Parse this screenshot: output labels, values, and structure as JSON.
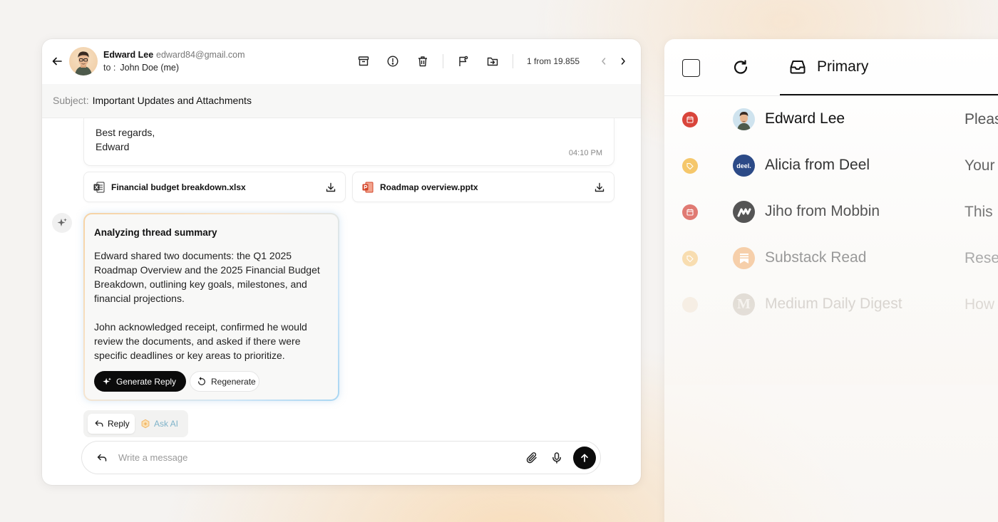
{
  "email": {
    "sender_name": "Edward Lee",
    "sender_email": "edward84@gmail.com",
    "to_label": "to :",
    "to_value": "John Doe (me)",
    "counter": "1 from 19.855",
    "subject_label": "Subject:",
    "subject": "Important Updates and Attachments",
    "message_lines": [
      "Best regards,",
      "Edward"
    ],
    "message_time": "04:10 PM",
    "attachments": [
      {
        "name": "Financial budget breakdown.xlsx",
        "icon": "excel-file-icon"
      },
      {
        "name": "Roadmap overview.pptx",
        "icon": "powerpoint-file-icon"
      }
    ]
  },
  "ai_summary": {
    "title": "Analyzing thread summary",
    "paragraph1_lines": [
      "Edward shared two documents: the Q1 2025",
      "Roadmap Overview and the 2025 Financial Budget",
      "Breakdown, outlining key goals, milestones, and",
      "financial projections."
    ],
    "paragraph2_lines": [
      "John acknowledged receipt, confirmed he would",
      "review the documents, and asked if there were",
      "specific deadlines or key areas to prioritize."
    ],
    "generate_label": "Generate Reply",
    "regenerate_label": "Regenerate"
  },
  "reply_tabs": {
    "reply": "Reply",
    "ask_ai": "Ask AI"
  },
  "compose": {
    "placeholder": "Write a message"
  },
  "inbox": {
    "tab_label": "Primary",
    "rows": [
      {
        "name": "Edward Lee",
        "preview": "Pleas",
        "tag_color": "#d9453b"
      },
      {
        "name": "Alicia from Deel",
        "preview": "Your",
        "tag_color": "#f5c76b",
        "avatar_text": "deel."
      },
      {
        "name": "Jiho from Mobbin",
        "preview": "This",
        "tag_color": "#e07a73"
      },
      {
        "name": "Substack Read",
        "preview": "Rese",
        "tag_color": "#f8d9a8"
      },
      {
        "name": "Medium Daily Digest",
        "preview": "How",
        "tag_color": "#f6eee4",
        "avatar_text": "M"
      }
    ]
  }
}
